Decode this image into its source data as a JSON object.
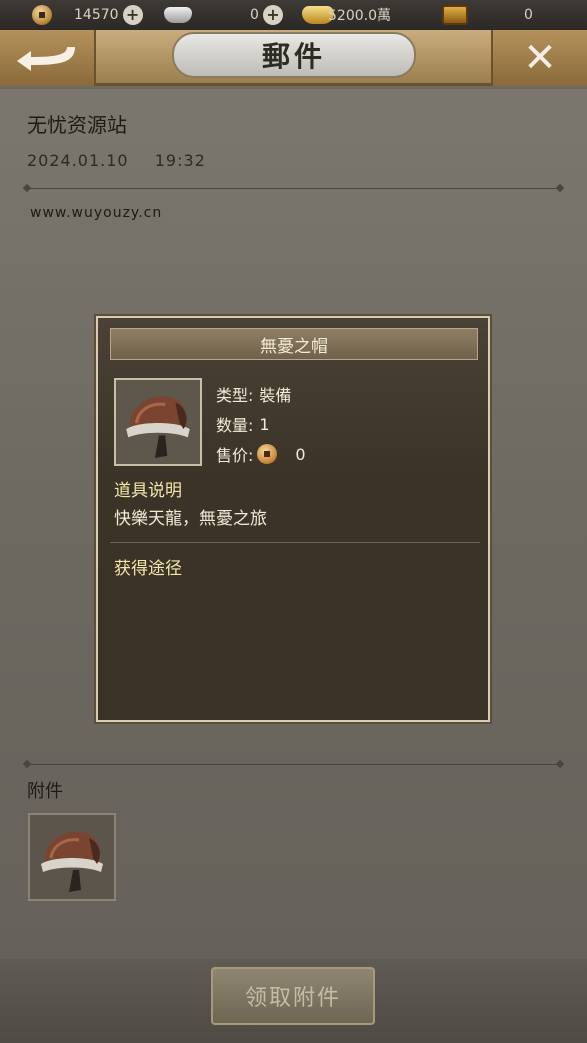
{
  "topbar": {
    "coins": "14570",
    "silver": "0",
    "gold": "5200.0萬",
    "chest": "0"
  },
  "header": {
    "title": "郵件"
  },
  "mail": {
    "sender": "无忧资源站",
    "date": "2024.01.10",
    "time": "19:32",
    "body": "www.wuyouzy.cn",
    "attachment_label": "附件",
    "claim_button": "领取附件"
  },
  "item_popup": {
    "name": "無憂之帽",
    "type_label": "类型:",
    "type_value": "裝備",
    "qty_label": "数量:",
    "qty_value": "1",
    "price_label": "售价:",
    "price_value": "0",
    "desc_heading": "道具说明",
    "desc_text": "快樂天龍，無憂之旅",
    "source_heading": "获得途径"
  },
  "icons": [
    "coin-icon",
    "silver-ingot-icon",
    "gold-ingot-icon",
    "treasure-chest-icon",
    "plus-icon",
    "back-arrow-icon",
    "close-icon",
    "hat-item-icon"
  ]
}
